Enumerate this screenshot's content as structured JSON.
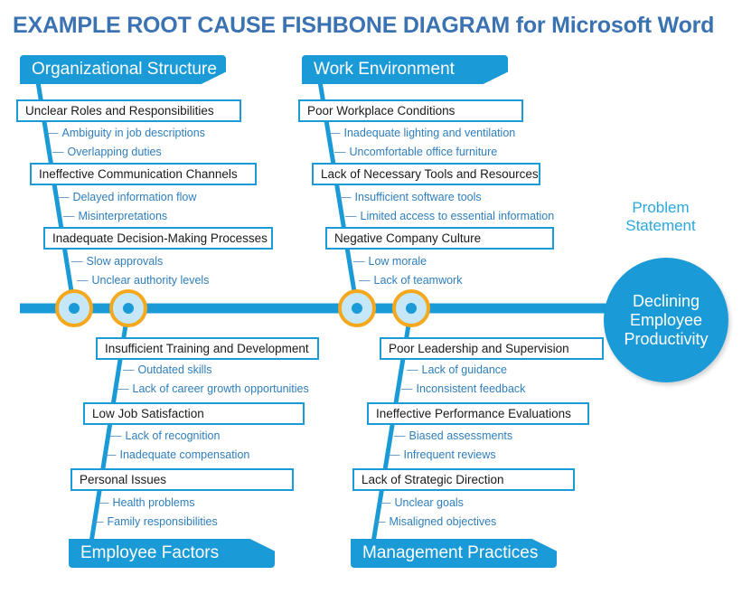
{
  "title": "EXAMPLE ROOT CAUSE FISHBONE DIAGRAM for Microsoft Word",
  "colors": {
    "title_blue": "#3b72b2",
    "brand_blue": "#1b9ad8",
    "sub_text_blue": "#2e7ebd",
    "node_ring": "#f5a81c",
    "node_fill": "#c5e7f7",
    "node_dot": "#1b9ad8",
    "box_text": "#1a1a1a"
  },
  "problem_statement": {
    "label": "Problem Statement",
    "label_line1": "Problem",
    "label_line2": "Statement",
    "text": "Declining Employee Productivity",
    "line1": "Declining",
    "line2": "Employee",
    "line3": "Productivity"
  },
  "categories": [
    {
      "id": "organizational-structure",
      "name": "Organizational Structure",
      "position": "top-left",
      "causes": [
        {
          "label": "Unclear Roles and Responsibilities",
          "subs": [
            "Ambiguity in job descriptions",
            "Overlapping duties"
          ]
        },
        {
          "label": "Ineffective Communication Channels",
          "subs": [
            "Delayed information flow",
            "Misinterpretations"
          ]
        },
        {
          "label": "Inadequate Decision-Making Processes",
          "subs": [
            "Slow approvals",
            "Unclear authority levels"
          ]
        }
      ]
    },
    {
      "id": "work-environment",
      "name": "Work Environment",
      "position": "top-right",
      "causes": [
        {
          "label": "Poor Workplace Conditions",
          "subs": [
            "Inadequate lighting and ventilation",
            "Uncomfortable office furniture"
          ]
        },
        {
          "label": "Lack of Necessary Tools and Resources",
          "subs": [
            "Insufficient software tools",
            "Limited access to essential information"
          ]
        },
        {
          "label": "Negative Company Culture",
          "subs": [
            "Low morale",
            "Lack of teamwork"
          ]
        }
      ]
    },
    {
      "id": "employee-factors",
      "name": "Employee Factors",
      "position": "bottom-left",
      "causes": [
        {
          "label": "Insufficient Training and Development",
          "subs": [
            "Outdated skills",
            "Lack of career growth opportunities"
          ]
        },
        {
          "label": "Low Job Satisfaction",
          "subs": [
            "Lack of recognition",
            "Inadequate compensation"
          ]
        },
        {
          "label": "Personal Issues",
          "subs": [
            "Health problems",
            "Family responsibilities"
          ]
        }
      ]
    },
    {
      "id": "management-practices",
      "name": "Management Practices",
      "position": "bottom-right",
      "causes": [
        {
          "label": "Poor Leadership and Supervision",
          "subs": [
            "Lack of guidance",
            "Inconsistent feedback"
          ]
        },
        {
          "label": "Ineffective Performance Evaluations",
          "subs": [
            "Biased assessments",
            "Infrequent reviews"
          ]
        },
        {
          "label": "Lack of Strategic Direction",
          "subs": [
            "Unclear goals",
            "Misaligned objectives"
          ]
        }
      ]
    }
  ],
  "dash": "—"
}
